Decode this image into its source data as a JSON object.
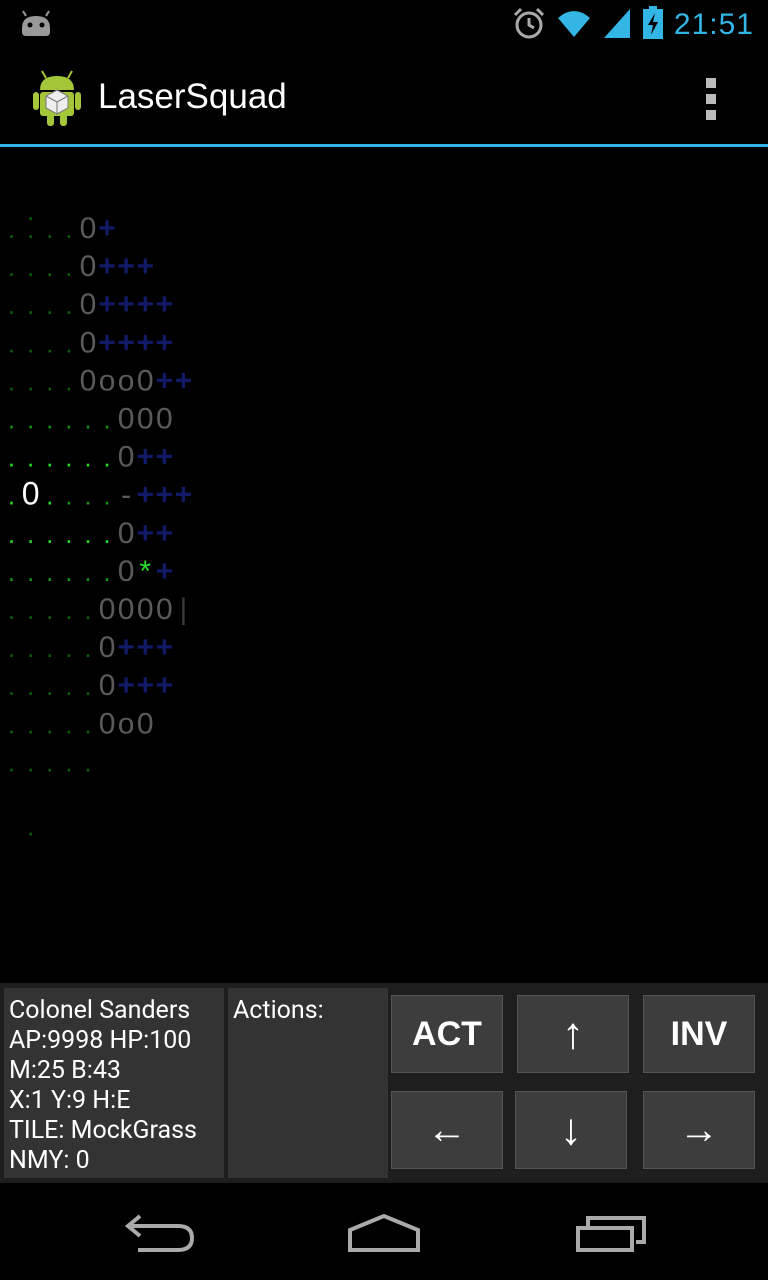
{
  "status_bar": {
    "time": "21:51",
    "icons": [
      "android-notification-icon",
      "alarm-icon",
      "wifi-icon",
      "signal-icon",
      "battery-charging-icon"
    ],
    "accent_color": "#33b5e5"
  },
  "action_bar": {
    "title": "LaserSquad",
    "icon": "android-app-icon",
    "overflow_icon": "overflow-menu-icon"
  },
  "map": {
    "rows": [
      [
        {
          "t": ".",
          "c": "g3"
        }
      ],
      [
        {
          "t": "....",
          "c": "g3"
        },
        {
          "t": "0",
          "c": "w1"
        },
        {
          "t": "+",
          "c": "b1"
        }
      ],
      [
        {
          "t": "....",
          "c": "g3"
        },
        {
          "t": "0",
          "c": "w1"
        },
        {
          "t": "+++",
          "c": "b1"
        }
      ],
      [
        {
          "t": "....",
          "c": "g3"
        },
        {
          "t": "0",
          "c": "w1"
        },
        {
          "t": "++++",
          "c": "b1"
        }
      ],
      [
        {
          "t": "....",
          "c": "g3"
        },
        {
          "t": "0",
          "c": "w1"
        },
        {
          "t": "++++",
          "c": "b1"
        }
      ],
      [
        {
          "t": "....",
          "c": "g3"
        },
        {
          "t": "0oo0",
          "c": "w1"
        },
        {
          "t": "++",
          "c": "b1"
        }
      ],
      [
        {
          "t": "......",
          "c": "g2"
        },
        {
          "t": "000",
          "c": "w1"
        }
      ],
      [
        {
          "t": "......",
          "c": "g1"
        },
        {
          "t": "0",
          "c": "w1"
        },
        {
          "t": "++",
          "c": "b1"
        }
      ],
      [
        {
          "t": ".",
          "c": "g1"
        },
        {
          "t": "0",
          "c": "w3"
        },
        {
          "t": ".",
          "c": "g1"
        },
        {
          "t": "...",
          "c": "g2"
        },
        {
          "t": "-",
          "c": "w1"
        },
        {
          "t": "+++",
          "c": "b1"
        }
      ],
      [
        {
          "t": "......",
          "c": "g1"
        },
        {
          "t": "0",
          "c": "w1"
        },
        {
          "t": "++",
          "c": "b1"
        }
      ],
      [
        {
          "t": "......",
          "c": "g2"
        },
        {
          "t": "0",
          "c": "w1"
        },
        {
          "t": "*",
          "c": "g1"
        },
        {
          "t": "+",
          "c": "b1"
        }
      ],
      [
        {
          "t": ".....",
          "c": "g3"
        },
        {
          "t": "0000",
          "c": "w1"
        },
        {
          "t": "|",
          "c": "w0"
        }
      ],
      [
        {
          "t": ".....",
          "c": "g3"
        },
        {
          "t": "0",
          "c": "w1"
        },
        {
          "t": "+++",
          "c": "b1"
        }
      ],
      [
        {
          "t": ".....",
          "c": "g3"
        },
        {
          "t": "0",
          "c": "w1"
        },
        {
          "t": "+++",
          "c": "b1"
        }
      ],
      [
        {
          "t": ".....",
          "c": "g3"
        },
        {
          "t": "0o0",
          "c": "w1"
        }
      ],
      [
        {
          "t": ".....",
          "c": "g3"
        }
      ],
      [
        {
          "t": ".",
          "c": "g3"
        }
      ]
    ]
  },
  "hud": {
    "info_lines": [
      "Colonel Sanders",
      "AP:9998 HP:100",
      "M:25 B:43",
      "X:1 Y:9 H:E",
      "TILE: MockGrass",
      "NMY: 0"
    ],
    "actions_label": "Actions:",
    "buttons": {
      "act": "ACT",
      "up": "↑",
      "inv": "INV",
      "left": "←",
      "down": "↓",
      "right": "→"
    }
  },
  "nav_bar": {
    "icons": [
      "back-icon",
      "home-icon",
      "recent-apps-icon"
    ]
  }
}
